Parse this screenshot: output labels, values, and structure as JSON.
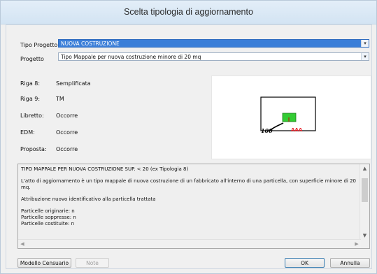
{
  "window": {
    "title": "Scelta tipologia di aggiornamento"
  },
  "form": {
    "tipo_progetto_label": "Tipo Progetto",
    "tipo_progetto_value": "NUOVA COSTRUZIONE",
    "progetto_label": "Progetto",
    "progetto_value": "Tipo Mappale per nuova costruzione minore di 20 mq"
  },
  "properties": [
    {
      "label": "Riga 8:",
      "value": "Semplificata"
    },
    {
      "label": "Riga 9:",
      "value": "TM"
    },
    {
      "label": "Libretto:",
      "value": "Occorre"
    },
    {
      "label": "EDM:",
      "value": "Occorre"
    },
    {
      "label": "Proposta:",
      "value": "Occorre"
    }
  ],
  "preview": {
    "number": "100",
    "code": "AAA"
  },
  "description": {
    "heading": "TIPO MAPPALE PER NUOVA COSTRUZIONE SUP. < 20 (ex Tipologia 8)",
    "paragraph": "L'atto di aggiornamento è un tipo mappale di nuova costruzione di un fabbricato all'interno di una particella, con superficie minore di 20 mq.",
    "attribution": "Attribuzione nuovo identificativo alla particella trattata",
    "particelle_originarie": "Particelle originarie: n",
    "particelle_soppresse": "Particelle soppresse: n",
    "particelle_costituite": "Particelle costituite: n"
  },
  "buttons": {
    "modello": "Modello Censuario",
    "note": "Note",
    "ok": "OK",
    "annulla": "Annulla"
  },
  "colors": {
    "selection": "#3a7ed8",
    "building_fill": "#33cc33",
    "code_text": "#e8202a"
  }
}
